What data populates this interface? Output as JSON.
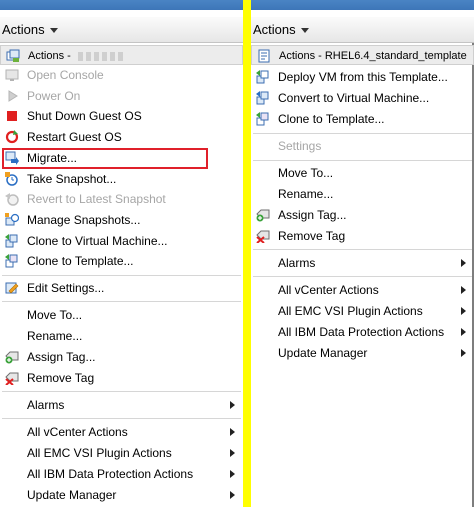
{
  "left_panel": {
    "header_label": "Actions",
    "menu_title": "Actions - ",
    "items": [
      {
        "label": "Open Console",
        "icon": "console-icon",
        "enabled": false
      },
      {
        "label": "Power On",
        "icon": "play-icon",
        "enabled": false
      },
      {
        "label": "Shut Down Guest OS",
        "icon": "stop-icon",
        "enabled": true
      },
      {
        "label": "Restart Guest OS",
        "icon": "restart-icon",
        "enabled": true
      },
      {
        "label": "Migrate...",
        "icon": "migrate-icon",
        "enabled": true,
        "highlighted": true
      },
      {
        "label": "Take Snapshot...",
        "icon": "snapshot-icon",
        "enabled": true
      },
      {
        "label": "Revert to Latest Snapshot",
        "icon": "revert-snapshot-icon",
        "enabled": false
      },
      {
        "label": "Manage Snapshots...",
        "icon": "manage-snapshots-icon",
        "enabled": true
      },
      {
        "label": "Clone to Virtual Machine...",
        "icon": "clone-vm-icon",
        "enabled": true
      },
      {
        "label": "Clone to Template...",
        "icon": "clone-template-icon",
        "enabled": true
      },
      {
        "label": "Edit Settings...",
        "icon": "edit-settings-icon",
        "enabled": true
      },
      {
        "label": "Move To...",
        "enabled": true
      },
      {
        "label": "Rename...",
        "enabled": true
      },
      {
        "label": "Assign Tag...",
        "icon": "tag-add-icon",
        "enabled": true
      },
      {
        "label": "Remove Tag",
        "icon": "tag-remove-icon",
        "enabled": true
      },
      {
        "label": "Alarms",
        "enabled": true,
        "submenu": true
      },
      {
        "label": "All vCenter Actions",
        "enabled": true,
        "submenu": true
      },
      {
        "label": "All EMC VSI Plugin Actions",
        "enabled": true,
        "submenu": true
      },
      {
        "label": "All IBM Data Protection Actions",
        "enabled": true,
        "submenu": true
      },
      {
        "label": "Update Manager",
        "enabled": true,
        "submenu": true
      }
    ]
  },
  "right_panel": {
    "header_label": "Actions",
    "menu_title": "Actions - RHEL6.4_standard_template",
    "items": [
      {
        "label": "Deploy VM from this Template...",
        "icon": "deploy-vm-icon",
        "enabled": true
      },
      {
        "label": "Convert to Virtual Machine...",
        "icon": "convert-vm-icon",
        "enabled": true
      },
      {
        "label": "Clone to Template...",
        "icon": "clone-template-icon",
        "enabled": true
      },
      {
        "label": "Settings",
        "enabled": false
      },
      {
        "label": "Move To...",
        "enabled": true
      },
      {
        "label": "Rename...",
        "enabled": true
      },
      {
        "label": "Assign Tag...",
        "icon": "tag-add-icon",
        "enabled": true
      },
      {
        "label": "Remove Tag",
        "icon": "tag-remove-icon",
        "enabled": true
      },
      {
        "label": "Alarms",
        "enabled": true,
        "submenu": true
      },
      {
        "label": "All vCenter Actions",
        "enabled": true,
        "submenu": true
      },
      {
        "label": "All EMC VSI Plugin Actions",
        "enabled": true,
        "submenu": true
      },
      {
        "label": "All IBM Data Protection Actions",
        "enabled": true,
        "submenu": true
      },
      {
        "label": "Update Manager",
        "enabled": true,
        "submenu": true
      }
    ]
  },
  "colors": {
    "divider": "#ffff00",
    "highlight_border": "#e0202a",
    "disabled_text": "#a6a6a6",
    "top_strip": "#3d76b8"
  }
}
